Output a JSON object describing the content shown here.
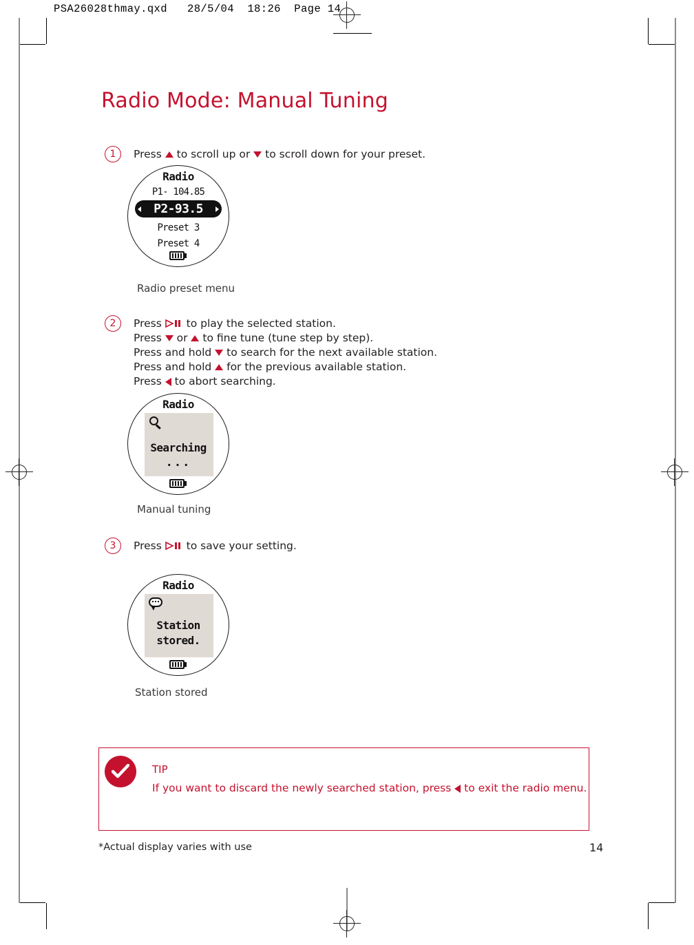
{
  "prepress": {
    "header_line": "PSA26028thmay.qxd   28/5/04  18:26  Page 14"
  },
  "colors": {
    "brand_red": "#C4122E",
    "body_text": "#231f20",
    "lcd_panel": "#e0dad5",
    "lcd_ink": "#111111"
  },
  "page": {
    "title": "Radio Mode: Manual Tuning",
    "footnote": "*Actual display varies with use",
    "page_number": "14"
  },
  "steps": [
    {
      "number": "1",
      "lines": [
        {
          "parts": [
            {
              "t": "text",
              "v": "Press "
            },
            {
              "t": "icon",
              "v": "triangle-up-icon"
            },
            {
              "t": "text",
              "v": " to scroll up or "
            },
            {
              "t": "icon",
              "v": "triangle-down-icon"
            },
            {
              "t": "text",
              "v": " to scroll down for your preset."
            }
          ]
        }
      ]
    },
    {
      "number": "2",
      "lines": [
        {
          "parts": [
            {
              "t": "text",
              "v": "Press "
            },
            {
              "t": "icon",
              "v": "play-pause-icon"
            },
            {
              "t": "text",
              "v": " to play the selected station."
            }
          ]
        },
        {
          "parts": [
            {
              "t": "text",
              "v": "Press "
            },
            {
              "t": "icon",
              "v": "triangle-down-icon"
            },
            {
              "t": "text",
              "v": " or "
            },
            {
              "t": "icon",
              "v": "triangle-up-icon"
            },
            {
              "t": "text",
              "v": " to fine tune (tune step by step)."
            }
          ]
        },
        {
          "parts": [
            {
              "t": "text",
              "v": "Press and hold "
            },
            {
              "t": "icon",
              "v": "triangle-down-icon"
            },
            {
              "t": "text",
              "v": " to search for the next available station."
            }
          ]
        },
        {
          "parts": [
            {
              "t": "text",
              "v": "Press and hold "
            },
            {
              "t": "icon",
              "v": "triangle-up-icon"
            },
            {
              "t": "text",
              "v": " for the previous available station."
            }
          ]
        },
        {
          "parts": [
            {
              "t": "text",
              "v": "Press "
            },
            {
              "t": "icon",
              "v": "triangle-left-icon"
            },
            {
              "t": "text",
              "v": "  to abort searching."
            }
          ]
        }
      ]
    },
    {
      "number": "3",
      "lines": [
        {
          "parts": [
            {
              "t": "text",
              "v": "Press "
            },
            {
              "t": "icon",
              "v": "play-pause-icon"
            },
            {
              "t": "text",
              "v": " to save your setting."
            }
          ]
        }
      ]
    }
  ],
  "displays": [
    {
      "name": "radio-preset-menu",
      "header": "Radio",
      "caption": "Radio preset menu",
      "rows": [
        {
          "label": "P1- 104.85",
          "selected": false
        },
        {
          "label": "P2-93.5",
          "selected": true
        },
        {
          "label": "Preset 3",
          "selected": false
        },
        {
          "label": "Preset 4",
          "selected": false
        }
      ],
      "battery_bars": 4
    },
    {
      "name": "manual-tuning",
      "header": "Radio",
      "caption": "Manual tuning",
      "icon": "search-icon",
      "big_text": "Searching",
      "dots": "...",
      "battery_bars": 4
    },
    {
      "name": "station-stored",
      "header": "Radio",
      "caption": "Station stored",
      "icon": "speech-bubble-icon",
      "big_text_line1": "Station",
      "big_text_line2": "stored.",
      "battery_bars": 4
    }
  ],
  "tip": {
    "icon": "check-circle-icon",
    "heading": "TIP",
    "body_before": "If you want to discard the newly searched station, press ",
    "body_icon": "triangle-left-icon",
    "body_after": "  to exit the radio menu."
  }
}
